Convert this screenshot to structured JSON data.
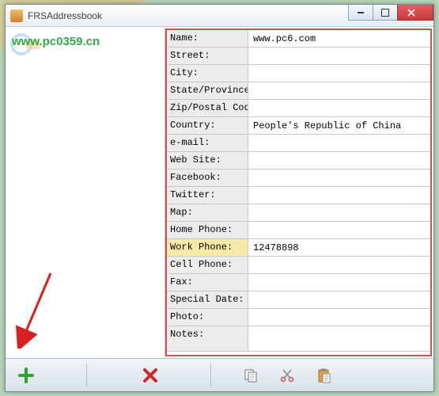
{
  "window": {
    "title": "FRSAddressbook"
  },
  "watermark": "www.pc0359.cn",
  "fields": [
    {
      "label": "Name:",
      "value": "www.pc6.com"
    },
    {
      "label": "Street:",
      "value": ""
    },
    {
      "label": "City:",
      "value": ""
    },
    {
      "label": "State/Province:",
      "value": ""
    },
    {
      "label": "Zip/Postal Code:",
      "value": ""
    },
    {
      "label": "Country:",
      "value": "People's Republic of China"
    },
    {
      "label": "e-mail:",
      "value": ""
    },
    {
      "label": "Web Site:",
      "value": ""
    },
    {
      "label": "Facebook:",
      "value": ""
    },
    {
      "label": "Twitter:",
      "value": ""
    },
    {
      "label": "Map:",
      "value": ""
    },
    {
      "label": "Home Phone:",
      "value": ""
    },
    {
      "label": "Work Phone:",
      "value": "12478898",
      "selected": true
    },
    {
      "label": "Cell Phone:",
      "value": ""
    },
    {
      "label": "Fax:",
      "value": ""
    },
    {
      "label": "Special Date:",
      "value": ""
    },
    {
      "label": "Photo:",
      "value": ""
    },
    {
      "label": "Notes:",
      "value": "",
      "tall": true
    }
  ],
  "toolbar": {
    "add": "add",
    "delete": "delete",
    "copy": "copy",
    "cut": "cut",
    "paste": "paste"
  }
}
